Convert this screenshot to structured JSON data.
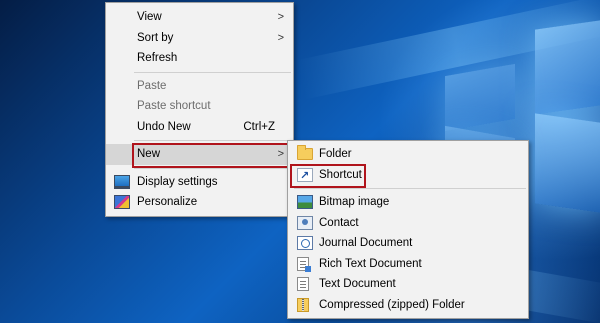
{
  "desktop": {
    "background_color": "#0a4a98"
  },
  "context_menu": {
    "items": [
      {
        "label": "View",
        "has_submenu": true,
        "enabled": true
      },
      {
        "label": "Sort by",
        "has_submenu": true,
        "enabled": true
      },
      {
        "label": "Refresh",
        "enabled": true
      },
      {
        "label": "Paste",
        "enabled": false
      },
      {
        "label": "Paste shortcut",
        "enabled": false
      },
      {
        "label": "Undo New",
        "shortcut": "Ctrl+Z",
        "enabled": true
      },
      {
        "label": "New",
        "has_submenu": true,
        "enabled": true,
        "highlighted": true
      },
      {
        "label": "Display settings",
        "icon": "display-icon",
        "enabled": true
      },
      {
        "label": "Personalize",
        "icon": "personalize-icon",
        "enabled": true
      }
    ]
  },
  "new_submenu": {
    "items": [
      {
        "label": "Folder",
        "icon": "folder-icon"
      },
      {
        "label": "Shortcut",
        "icon": "shortcut-icon",
        "highlighted": true
      },
      {
        "label": "Bitmap image",
        "icon": "bitmap-image-icon"
      },
      {
        "label": "Contact",
        "icon": "contact-icon"
      },
      {
        "label": "Journal Document",
        "icon": "journal-document-icon"
      },
      {
        "label": "Rich Text Document",
        "icon": "rich-text-document-icon"
      },
      {
        "label": "Text Document",
        "icon": "text-document-icon"
      },
      {
        "label": "Compressed (zipped) Folder",
        "icon": "compressed-folder-icon"
      }
    ]
  },
  "annotation_color": "#b0141c"
}
